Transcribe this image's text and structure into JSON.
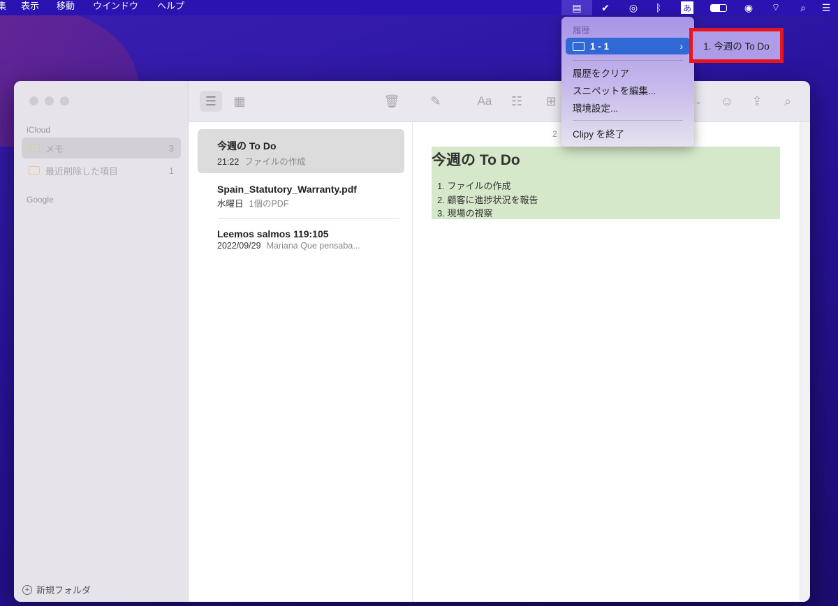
{
  "menubar": {
    "items": [
      "集",
      "表示",
      "移動",
      "ウインドウ",
      "ヘルプ"
    ],
    "ime": "あ"
  },
  "window": {
    "sidebar": {
      "sections": [
        {
          "label": "iCloud",
          "items": [
            {
              "label": "メモ",
              "count": "3",
              "selected": true
            },
            {
              "label": "最近削除した項目",
              "count": "1"
            }
          ]
        },
        {
          "label": "Google",
          "items": []
        }
      ],
      "new_folder": "新規フォルダ"
    },
    "toolbar": {
      "format": "Aa"
    },
    "notes": [
      {
        "title": "今週の To Do",
        "date": "21:22",
        "preview": "ファイルの作成",
        "selected": true
      },
      {
        "title": "Spain_Statutory_Warranty.pdf",
        "date": "水曜日",
        "preview": "1個のPDF"
      },
      {
        "title": "Leemos salmos 119:105",
        "date": "2022/09/29",
        "preview": "Mariana Que pensaba..."
      }
    ],
    "editor": {
      "date_partial": "2",
      "title": "今週の To Do",
      "items": [
        "ファイルの作成",
        "顧客に進捗状況を報告",
        "現場の視察"
      ],
      "highlight": "#d5e8c9"
    }
  },
  "clipy_menu": {
    "header": "履歴",
    "folder": "1 - 1",
    "clear": "履歴をクリア",
    "snippets": "スニペットを編集...",
    "prefs": "環境設定...",
    "quit": "Clipy を終了",
    "submenu_item": "1. 今週の To Do",
    "annotation_color": "#e8141e"
  }
}
